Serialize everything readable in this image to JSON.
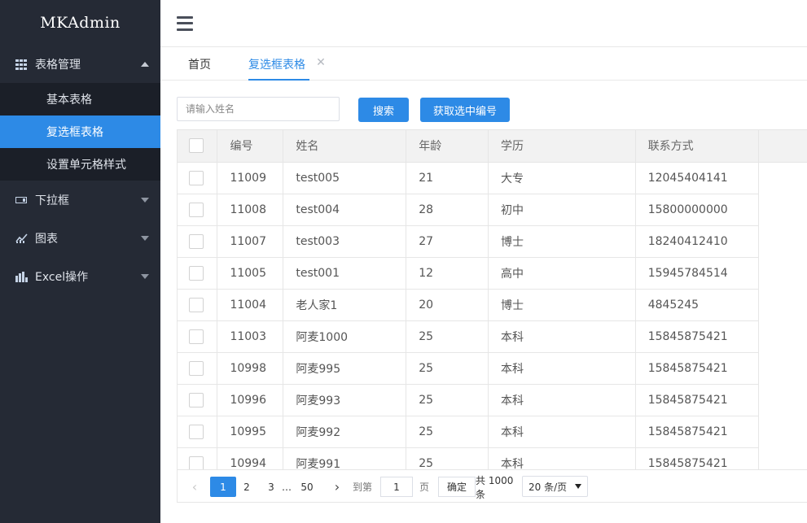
{
  "app": {
    "logo": "MKAdmin"
  },
  "sidebar": {
    "groups": [
      {
        "label": "表格管理",
        "icon": "table-grid-icon",
        "expanded": true,
        "items": [
          {
            "label": "基本表格",
            "active": false
          },
          {
            "label": "复选框表格",
            "active": true
          },
          {
            "label": "设置单元格样式",
            "active": false
          }
        ]
      },
      {
        "label": "下拉框",
        "icon": "dropdown-box-icon",
        "expanded": false
      },
      {
        "label": "图表",
        "icon": "line-chart-icon",
        "expanded": false
      },
      {
        "label": "Excel操作",
        "icon": "bar-chart-icon",
        "expanded": false
      }
    ]
  },
  "header": {
    "menu_icon": "hamburger-menu-icon"
  },
  "tabs": [
    {
      "label": "首页",
      "active": false
    },
    {
      "label": "复选框表格",
      "active": true,
      "closable": true
    }
  ],
  "toolbar": {
    "search_placeholder": "请输入姓名",
    "search_value": "",
    "search_label": "搜索",
    "get_selected_label": "获取选中编号"
  },
  "table": {
    "columns": [
      "编号",
      "姓名",
      "年龄",
      "学历",
      "联系方式"
    ],
    "rows": [
      [
        "11009",
        "test005",
        "21",
        "大专",
        "12045404141"
      ],
      [
        "11008",
        "test004",
        "28",
        "初中",
        "15800000000"
      ],
      [
        "11007",
        "test003",
        "27",
        "博士",
        "18240412410"
      ],
      [
        "11005",
        "test001",
        "12",
        "高中",
        "15945784514"
      ],
      [
        "11004",
        "老人家1",
        "20",
        "博士",
        "4845245"
      ],
      [
        "11003",
        "阿麦1000",
        "25",
        "本科",
        "15845875421"
      ],
      [
        "10998",
        "阿麦995",
        "25",
        "本科",
        "15845875421"
      ],
      [
        "10996",
        "阿麦993",
        "25",
        "本科",
        "15845875421"
      ],
      [
        "10995",
        "阿麦992",
        "25",
        "本科",
        "15845875421"
      ],
      [
        "10994",
        "阿麦991",
        "25",
        "本科",
        "15845875421"
      ]
    ]
  },
  "pagination": {
    "prev": "‹",
    "pages": [
      "1",
      "2",
      "3"
    ],
    "ellipsis": "…",
    "last": "50",
    "next": "›",
    "current": "1",
    "goto_label": "到第",
    "goto_value": "1",
    "page_unit": "页",
    "confirm_label": "确定",
    "total": "共 1000 条",
    "page_size": "20 条/页"
  },
  "colors": {
    "accent": "#2d8ae6",
    "sidebar_bg": "#252a35",
    "submenu_bg": "#1b1f28"
  }
}
